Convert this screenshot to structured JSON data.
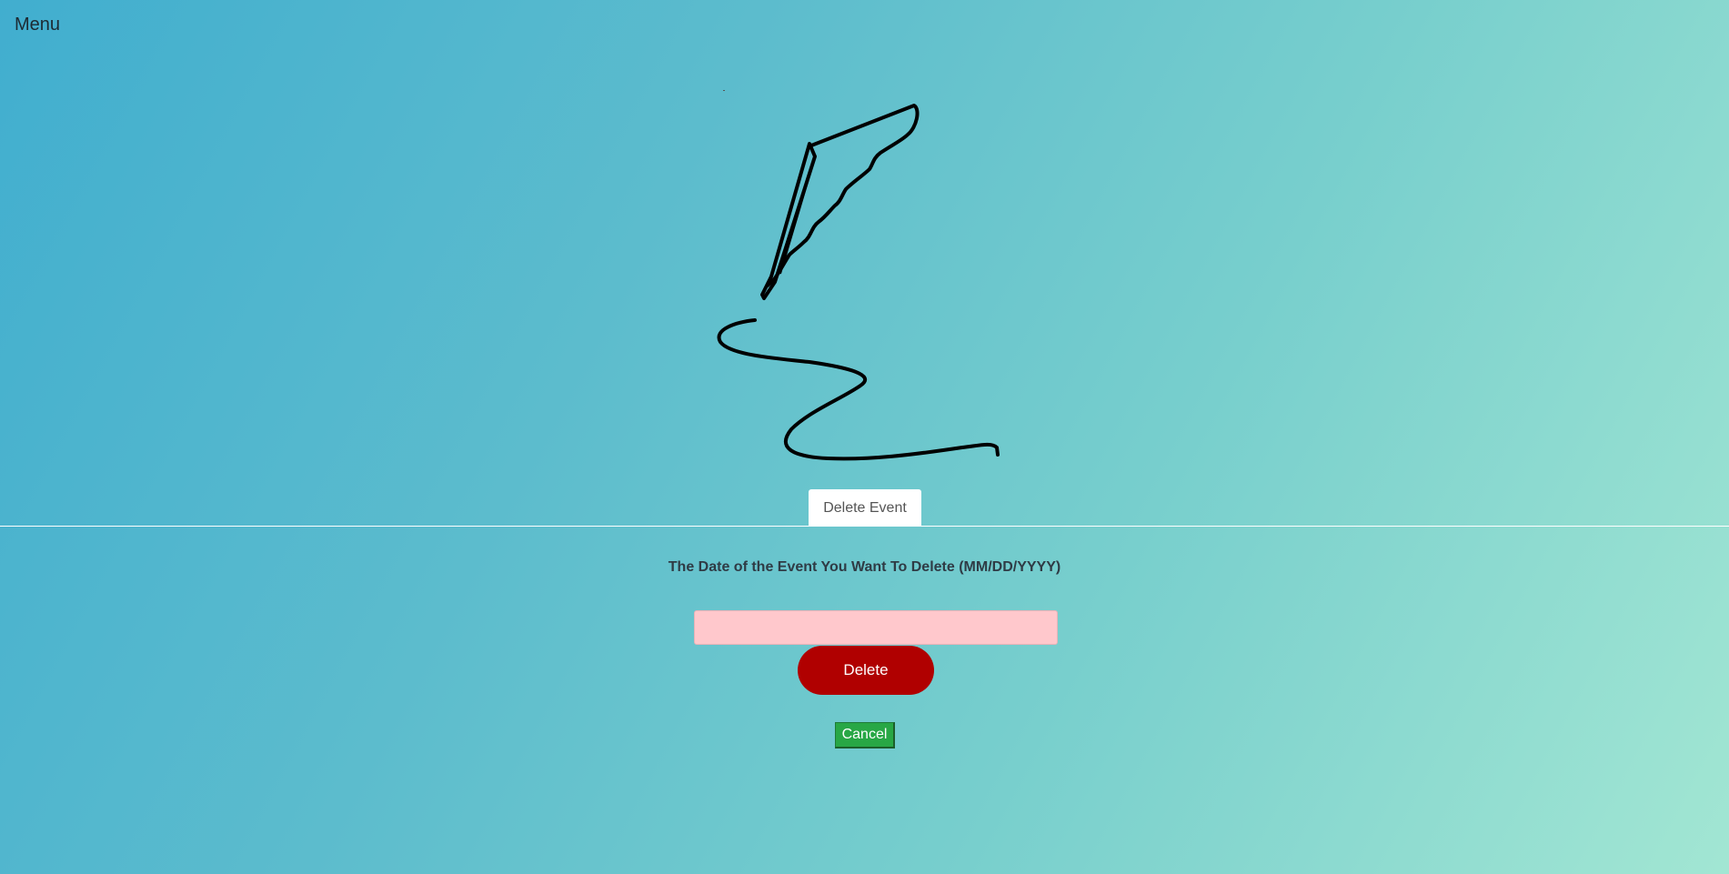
{
  "nav": {
    "menu_label": "Menu"
  },
  "logo": {
    "icon": "quill-pen-signature-icon"
  },
  "tab": {
    "label": "Delete Event"
  },
  "form": {
    "prompt": "The Date of the Event You Want To Delete (MM/DD/YYYY)",
    "date_value": "",
    "delete_label": "Delete",
    "cancel_label": "Cancel"
  },
  "colors": {
    "gradient_start": "#41aecf",
    "gradient_end": "#a2e6d3",
    "input_background": "#ffc8cc",
    "delete_button": "#b00000",
    "cancel_button": "#28a745"
  }
}
